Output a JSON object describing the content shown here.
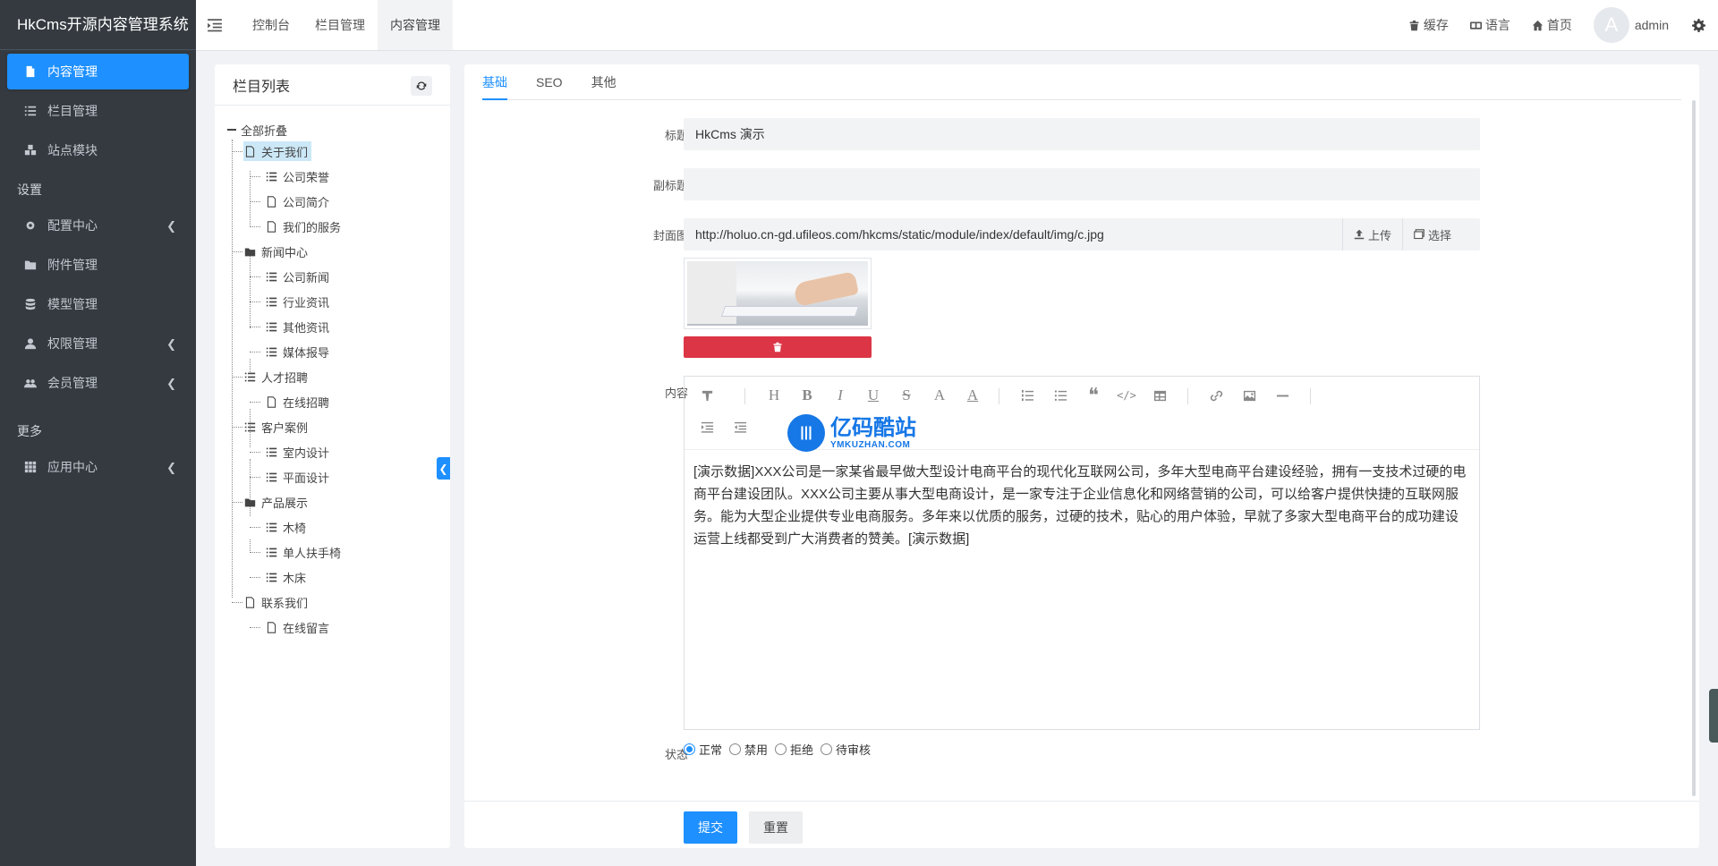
{
  "brand": "HkCms开源内容管理系统",
  "sidebar": {
    "items": [
      {
        "label": "内容管理",
        "icon": "file-icon",
        "active": true
      },
      {
        "label": "栏目管理",
        "icon": "list-icon"
      },
      {
        "label": "站点模块",
        "icon": "cubes-icon"
      }
    ],
    "header_settings": "设置",
    "settings_items": [
      {
        "label": "配置中心",
        "icon": "gear-icon"
      },
      {
        "label": "附件管理",
        "icon": "folder-icon"
      },
      {
        "label": "模型管理",
        "icon": "database-icon"
      },
      {
        "label": "权限管理",
        "icon": "user-icon"
      },
      {
        "label": "会员管理",
        "icon": "users-icon"
      }
    ],
    "header_more": "更多",
    "more_items": [
      {
        "label": "应用中心",
        "icon": "grid-icon"
      }
    ]
  },
  "topbar": {
    "links": [
      "控制台",
      "栏目管理",
      "内容管理"
    ],
    "cache": "缓存",
    "language": "语言",
    "home": "首页",
    "avatar_letter": "A",
    "user": "admin"
  },
  "tree": {
    "title": "栏目列表",
    "root": "全部折叠",
    "nodes": [
      "关于我们",
      "公司荣誉",
      "公司简介",
      "我们的服务",
      "新闻中心",
      "公司新闻",
      "行业资讯",
      "其他资讯",
      "媒体报导",
      "人才招聘",
      "在线招聘",
      "客户案例",
      "室内设计",
      "平面设计",
      "产品展示",
      "木椅",
      "单人扶手椅",
      "木床",
      "联系我们",
      "在线留言"
    ]
  },
  "tabs": [
    "基础",
    "SEO",
    "其他"
  ],
  "form": {
    "title_label": "标题",
    "title_value": "HkCms 演示",
    "subtitle_label": "副标题",
    "subtitle_value": "",
    "cover_label": "封面图",
    "cover_value": "http://holuo.cn-gd.ufileos.com/hkcms/static/module/index/default/img/c.jpg",
    "upload": "上传",
    "choose": "选择",
    "content_label": "内容",
    "content_text": "[演示数据]XXX公司是一家某省最早做大型设计电商平台的现代化互联网公司，多年大型电商平台建设经验，拥有一支技术过硬的电商平台建设团队。XXX公司主要从事大型电商设计，是一家专注于企业信息化和网络营销的公司，可以给客户提供快捷的互联网服务。能为大型企业提供专业电商服务。多年来以优质的服务，过硬的技术，贴心的用户体验，早就了多家大型电商平台的成功建设运营上线都受到广大消费者的赞美。[演示数据]",
    "watermark_cn": "亿码酷站",
    "watermark_en": "YMKUZHAN.COM",
    "status_label": "状态",
    "status_options": [
      "正常",
      "禁用",
      "拒绝",
      "待审核"
    ],
    "status_selected": "正常",
    "submit": "提交",
    "reset": "重置"
  },
  "colors": {
    "accent": "#1e90ff",
    "sidebar_bg": "#343a40",
    "danger": "#dc3545"
  }
}
